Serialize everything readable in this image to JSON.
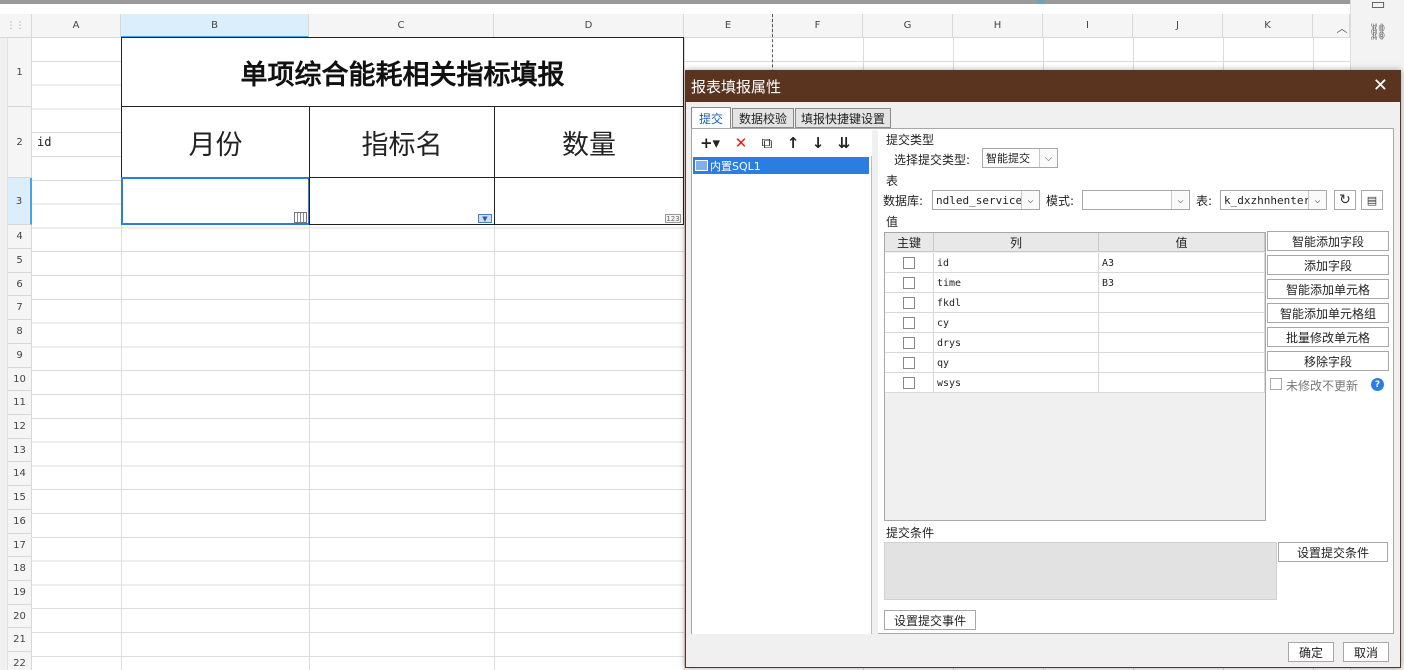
{
  "sheet": {
    "columns": [
      "A",
      "B",
      "C",
      "D",
      "E",
      "F",
      "G",
      "H",
      "I",
      "J",
      "K"
    ],
    "rows": [
      "1",
      "2",
      "3",
      "4",
      "5",
      "6",
      "7",
      "8",
      "9",
      "10",
      "11",
      "12",
      "13",
      "14",
      "15",
      "16",
      "17",
      "18",
      "19",
      "20",
      "21",
      "22"
    ],
    "title": "单项综合能耗相关指标填报",
    "a2_value": "id",
    "headers": [
      "月份",
      "指标名",
      "数量"
    ],
    "icons": {
      "b3": "calendar-icon",
      "c3": "dropdown-icon",
      "d3": "number-icon"
    },
    "number_icon_text": "123"
  },
  "dialog": {
    "title": "报表填报属性",
    "close": "✕",
    "tabs": [
      "提交",
      "数据校验",
      "填报快捷键设置"
    ],
    "active_tab": 0,
    "toolbar": {
      "add": "+▾",
      "delete": "✕",
      "copy": "⧉",
      "up": "↑",
      "down": "↓",
      "bottom": "⇊"
    },
    "list_item": "内置SQL1",
    "submit_type": {
      "section": "提交类型",
      "label": "选择提交类型:",
      "value": "智能提交"
    },
    "table_section": {
      "section": "表",
      "db_label": "数据库:",
      "db_value": "ndled_service",
      "mode_label": "模式:",
      "mode_value": "",
      "table_label": "表:",
      "table_value": "k_dxzhnhenter"
    },
    "value_section": {
      "section": "值",
      "headers": [
        "主键",
        "列",
        "值"
      ],
      "rows": [
        {
          "col": "id",
          "val": "A3"
        },
        {
          "col": "time",
          "val": "B3"
        },
        {
          "col": "fkdl",
          "val": ""
        },
        {
          "col": "cy",
          "val": ""
        },
        {
          "col": "drys",
          "val": ""
        },
        {
          "col": "qy",
          "val": ""
        },
        {
          "col": "wsys",
          "val": ""
        }
      ],
      "buttons": [
        "智能添加字段",
        "添加字段",
        "智能添加单元格",
        "智能添加单元格组",
        "批量修改单元格",
        "移除字段"
      ],
      "unmodified_label": "未修改不更新",
      "help": "?"
    },
    "condition": {
      "section": "提交条件",
      "button": "设置提交条件"
    },
    "event_button": "设置提交事件",
    "ok": "确定",
    "cancel": "取消"
  }
}
